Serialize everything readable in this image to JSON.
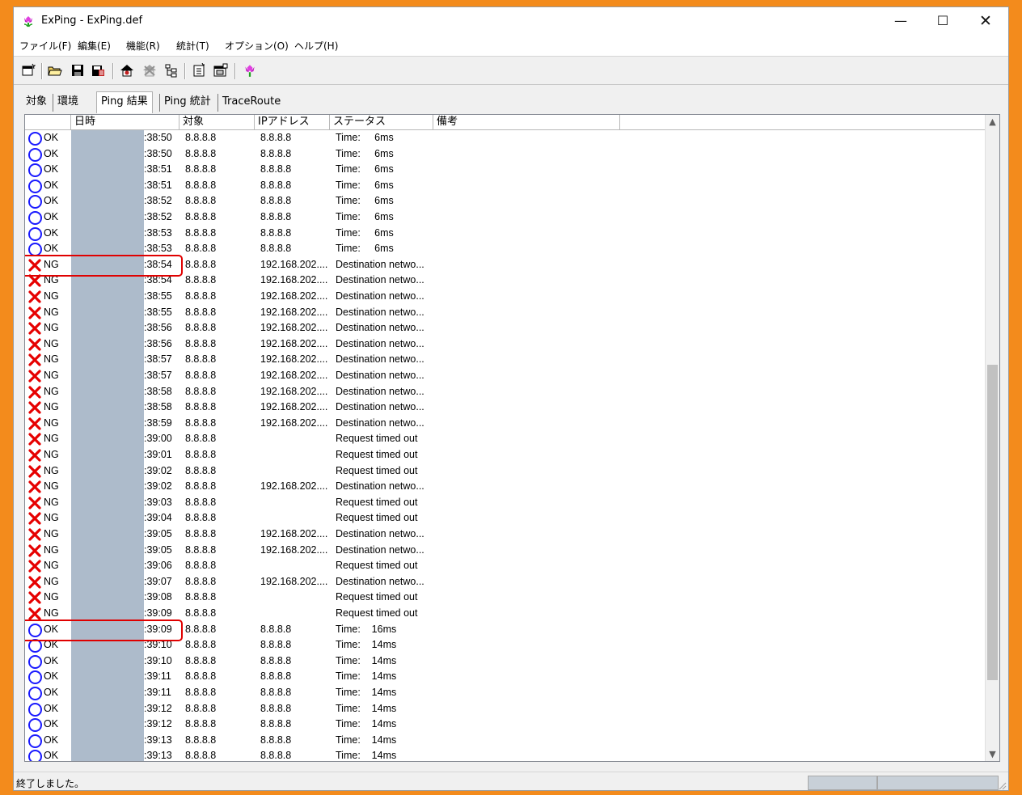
{
  "window": {
    "title": "ExPing - ExPing.def",
    "min_glyph": "—",
    "max_glyph": "☐",
    "close_glyph": "✕",
    "icon": "tulip-icon"
  },
  "menu": [
    "ファイル(F)",
    "編集(E)",
    "機能(R)",
    "統計(T)",
    "オプション(O)",
    "ヘルプ(H)"
  ],
  "toolbar_icons": [
    "new-file-icon",
    "open-folder-icon",
    "save-icon",
    "save-as-icon",
    "start-ping-icon",
    "stop-ping-icon",
    "tree-icon",
    "new-target-icon",
    "properties-icon",
    "tulip-icon"
  ],
  "tabs": [
    "対象",
    "環境",
    "Ping 結果",
    "Ping 統計",
    "TraceRoute"
  ],
  "active_tab": "Ping 結果",
  "columns": [
    "",
    "日時",
    "対象",
    "IPアドレス",
    "ステータス",
    "備考"
  ],
  "rows": [
    {
      "result": "OK",
      "time": ":38:50",
      "target": "8.8.8.8",
      "ip": "8.8.8.8",
      "status": "Time:     6ms"
    },
    {
      "result": "OK",
      "time": ":38:50",
      "target": "8.8.8.8",
      "ip": "8.8.8.8",
      "status": "Time:     6ms"
    },
    {
      "result": "OK",
      "time": ":38:51",
      "target": "8.8.8.8",
      "ip": "8.8.8.8",
      "status": "Time:     6ms"
    },
    {
      "result": "OK",
      "time": ":38:51",
      "target": "8.8.8.8",
      "ip": "8.8.8.8",
      "status": "Time:     6ms"
    },
    {
      "result": "OK",
      "time": ":38:52",
      "target": "8.8.8.8",
      "ip": "8.8.8.8",
      "status": "Time:     6ms"
    },
    {
      "result": "OK",
      "time": ":38:52",
      "target": "8.8.8.8",
      "ip": "8.8.8.8",
      "status": "Time:     6ms"
    },
    {
      "result": "OK",
      "time": ":38:53",
      "target": "8.8.8.8",
      "ip": "8.8.8.8",
      "status": "Time:     6ms"
    },
    {
      "result": "OK",
      "time": ":38:53",
      "target": "8.8.8.8",
      "ip": "8.8.8.8",
      "status": "Time:     6ms"
    },
    {
      "result": "NG",
      "time": ":38:54",
      "target": "8.8.8.8",
      "ip": "192.168.202....",
      "status": "Destination netwo..."
    },
    {
      "result": "NG",
      "time": ":38:54",
      "target": "8.8.8.8",
      "ip": "192.168.202....",
      "status": "Destination netwo..."
    },
    {
      "result": "NG",
      "time": ":38:55",
      "target": "8.8.8.8",
      "ip": "192.168.202....",
      "status": "Destination netwo..."
    },
    {
      "result": "NG",
      "time": ":38:55",
      "target": "8.8.8.8",
      "ip": "192.168.202....",
      "status": "Destination netwo..."
    },
    {
      "result": "NG",
      "time": ":38:56",
      "target": "8.8.8.8",
      "ip": "192.168.202....",
      "status": "Destination netwo..."
    },
    {
      "result": "NG",
      "time": ":38:56",
      "target": "8.8.8.8",
      "ip": "192.168.202....",
      "status": "Destination netwo..."
    },
    {
      "result": "NG",
      "time": ":38:57",
      "target": "8.8.8.8",
      "ip": "192.168.202....",
      "status": "Destination netwo..."
    },
    {
      "result": "NG",
      "time": ":38:57",
      "target": "8.8.8.8",
      "ip": "192.168.202....",
      "status": "Destination netwo..."
    },
    {
      "result": "NG",
      "time": ":38:58",
      "target": "8.8.8.8",
      "ip": "192.168.202....",
      "status": "Destination netwo..."
    },
    {
      "result": "NG",
      "time": ":38:58",
      "target": "8.8.8.8",
      "ip": "192.168.202....",
      "status": "Destination netwo..."
    },
    {
      "result": "NG",
      "time": ":38:59",
      "target": "8.8.8.8",
      "ip": "192.168.202....",
      "status": "Destination netwo..."
    },
    {
      "result": "NG",
      "time": ":39:00",
      "target": "8.8.8.8",
      "ip": "",
      "status": "Request timed out"
    },
    {
      "result": "NG",
      "time": ":39:01",
      "target": "8.8.8.8",
      "ip": "",
      "status": "Request timed out"
    },
    {
      "result": "NG",
      "time": ":39:02",
      "target": "8.8.8.8",
      "ip": "",
      "status": "Request timed out"
    },
    {
      "result": "NG",
      "time": ":39:02",
      "target": "8.8.8.8",
      "ip": "192.168.202....",
      "status": "Destination netwo..."
    },
    {
      "result": "NG",
      "time": ":39:03",
      "target": "8.8.8.8",
      "ip": "",
      "status": "Request timed out"
    },
    {
      "result": "NG",
      "time": ":39:04",
      "target": "8.8.8.8",
      "ip": "",
      "status": "Request timed out"
    },
    {
      "result": "NG",
      "time": ":39:05",
      "target": "8.8.8.8",
      "ip": "192.168.202....",
      "status": "Destination netwo..."
    },
    {
      "result": "NG",
      "time": ":39:05",
      "target": "8.8.8.8",
      "ip": "192.168.202....",
      "status": "Destination netwo..."
    },
    {
      "result": "NG",
      "time": ":39:06",
      "target": "8.8.8.8",
      "ip": "",
      "status": "Request timed out"
    },
    {
      "result": "NG",
      "time": ":39:07",
      "target": "8.8.8.8",
      "ip": "192.168.202....",
      "status": "Destination netwo..."
    },
    {
      "result": "NG",
      "time": ":39:08",
      "target": "8.8.8.8",
      "ip": "",
      "status": "Request timed out"
    },
    {
      "result": "NG",
      "time": ":39:09",
      "target": "8.8.8.8",
      "ip": "",
      "status": "Request timed out"
    },
    {
      "result": "OK",
      "time": ":39:09",
      "target": "8.8.8.8",
      "ip": "8.8.8.8",
      "status": "Time:    16ms"
    },
    {
      "result": "OK",
      "time": ":39:10",
      "target": "8.8.8.8",
      "ip": "8.8.8.8",
      "status": "Time:    14ms"
    },
    {
      "result": "OK",
      "time": ":39:10",
      "target": "8.8.8.8",
      "ip": "8.8.8.8",
      "status": "Time:    14ms"
    },
    {
      "result": "OK",
      "time": ":39:11",
      "target": "8.8.8.8",
      "ip": "8.8.8.8",
      "status": "Time:    14ms"
    },
    {
      "result": "OK",
      "time": ":39:11",
      "target": "8.8.8.8",
      "ip": "8.8.8.8",
      "status": "Time:    14ms"
    },
    {
      "result": "OK",
      "time": ":39:12",
      "target": "8.8.8.8",
      "ip": "8.8.8.8",
      "status": "Time:    14ms"
    },
    {
      "result": "OK",
      "time": ":39:12",
      "target": "8.8.8.8",
      "ip": "8.8.8.8",
      "status": "Time:    14ms"
    },
    {
      "result": "OK",
      "time": ":39:13",
      "target": "8.8.8.8",
      "ip": "8.8.8.8",
      "status": "Time:    14ms"
    },
    {
      "result": "OK",
      "time": ":39:13",
      "target": "8.8.8.8",
      "ip": "8.8.8.8",
      "status": "Time:    14ms"
    }
  ],
  "highlighted_rows": [
    8,
    31
  ],
  "status_bar": "終了しました。",
  "colors": {
    "ok": "#1a1aff",
    "ng": "#e60000",
    "highlight": "#e00000",
    "redacted": "#adbbcb",
    "frame": "#f38b1c"
  }
}
